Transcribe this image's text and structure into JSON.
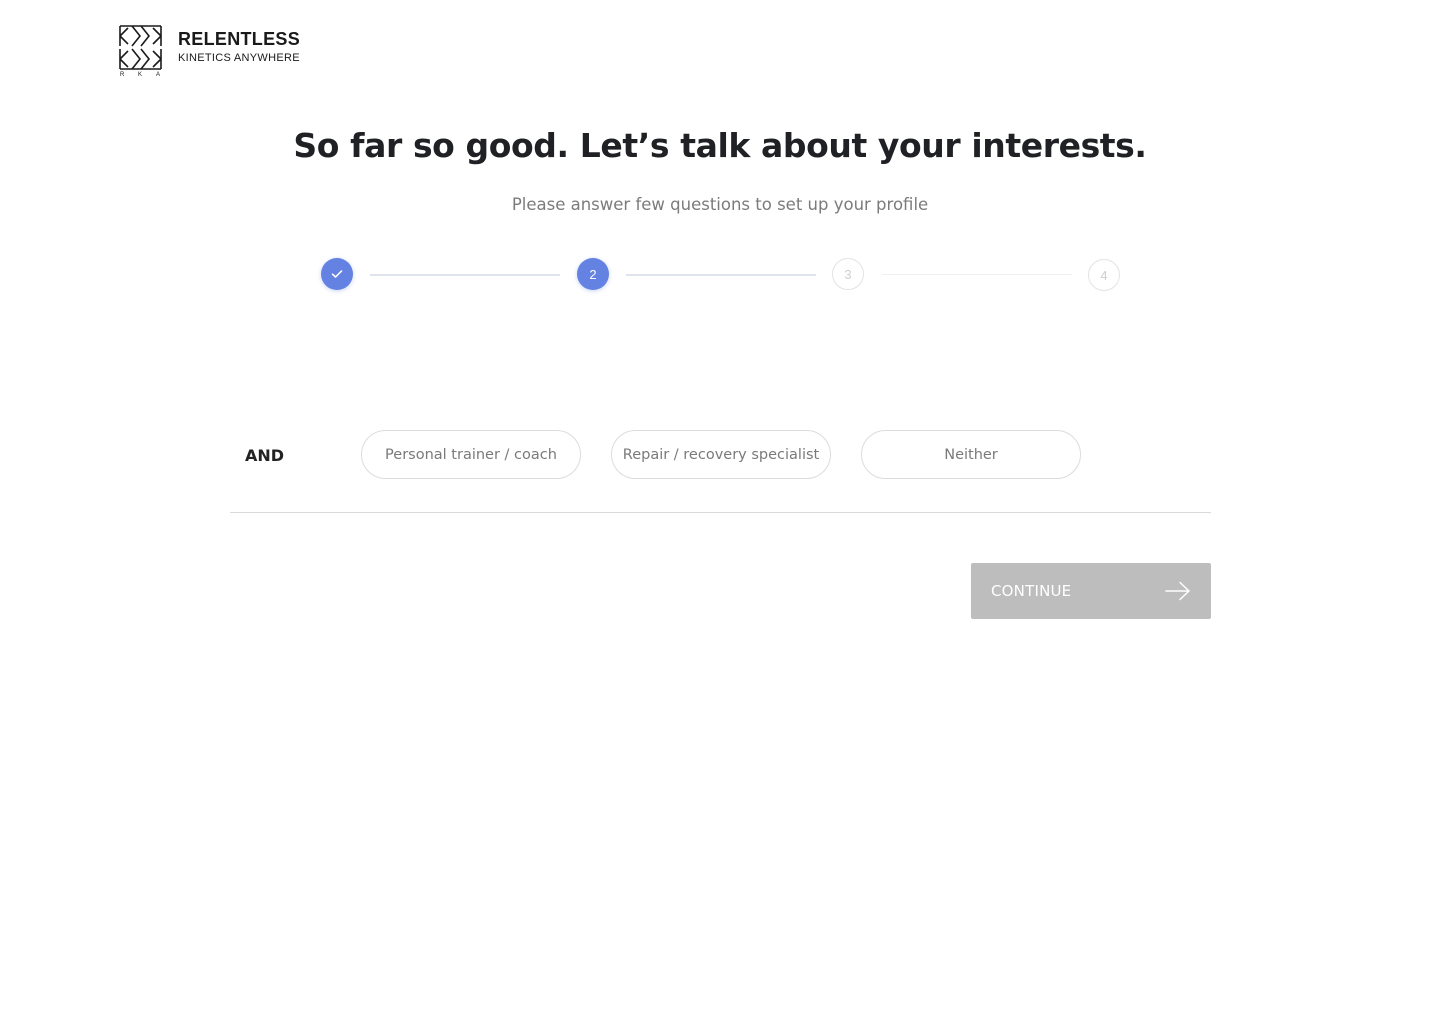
{
  "brand": {
    "name": "RELENTLESS",
    "tagline": "KINETICS ANYWHERE",
    "mark_letters": [
      "R",
      "K",
      "A"
    ]
  },
  "header": {
    "title": "So far so good. Let’s talk about your interests.",
    "subtitle": "Please answer few questions to set up your profile"
  },
  "stepper": {
    "steps": [
      {
        "label": "",
        "state": "done"
      },
      {
        "label": "2",
        "state": "active"
      },
      {
        "label": "3",
        "state": "pending"
      },
      {
        "label": "4",
        "state": "pending"
      }
    ]
  },
  "question": {
    "prefix": "AND",
    "options": [
      "Personal trainer / coach",
      "Repair / recovery specialist",
      "Neither"
    ]
  },
  "actions": {
    "continue_label": "CONTINUE"
  },
  "colors": {
    "accent": "#6482e2",
    "button_disabled": "#bdbdbd"
  }
}
